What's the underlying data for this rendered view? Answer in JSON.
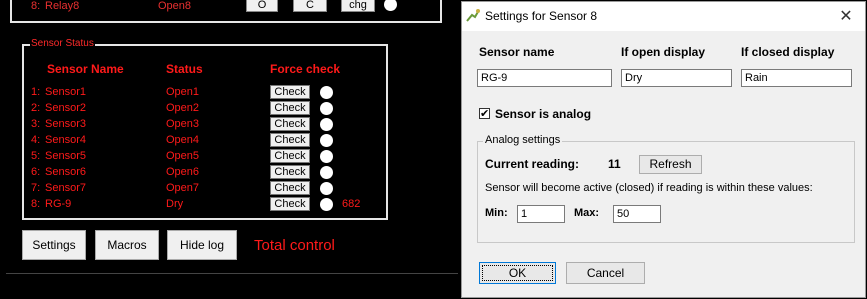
{
  "relay_row": {
    "index": "8:",
    "name": "Relay8",
    "status": "Open8",
    "btn_o": "O",
    "btn_c": "C",
    "btn_chg": "chg"
  },
  "sensor_status": {
    "group_label": "Sensor Status",
    "headers": {
      "name": "Sensor Name",
      "status": "Status",
      "force": "Force check"
    },
    "check_label": "Check",
    "rows": [
      {
        "index": "1:",
        "name": "Sensor1",
        "status": "Open1",
        "reading": ""
      },
      {
        "index": "2:",
        "name": "Sensor2",
        "status": "Open2",
        "reading": ""
      },
      {
        "index": "3:",
        "name": "Sensor3",
        "status": "Open3",
        "reading": ""
      },
      {
        "index": "4:",
        "name": "Sensor4",
        "status": "Open4",
        "reading": ""
      },
      {
        "index": "5:",
        "name": "Sensor5",
        "status": "Open5",
        "reading": ""
      },
      {
        "index": "6:",
        "name": "Sensor6",
        "status": "Open6",
        "reading": ""
      },
      {
        "index": "7:",
        "name": "Sensor7",
        "status": "Open7",
        "reading": ""
      },
      {
        "index": "8:",
        "name": "RG-9",
        "status": "Dry",
        "reading": "682"
      }
    ]
  },
  "bottom_bar": {
    "settings": "Settings",
    "macros": "Macros",
    "hide_log": "Hide log",
    "total_control": "Total control"
  },
  "dialog": {
    "title": "Settings for Sensor 8",
    "close": "✕",
    "labels": {
      "sensor_name": "Sensor name",
      "open_display": "If open display",
      "closed_display": "If closed display"
    },
    "values": {
      "sensor_name": "RG-9",
      "open_display": "Dry",
      "closed_display": "Rain"
    },
    "analog_checkbox": {
      "label": "Sensor is analog",
      "checked": "✔"
    },
    "analog": {
      "group_label": "Analog settings",
      "current_label": "Current reading:",
      "current_value": "11",
      "refresh": "Refresh",
      "description": "Sensor will become active (closed) if reading is within these values:",
      "min_label": "Min:",
      "min_value": "1",
      "max_label": "Max:",
      "max_value": "50"
    },
    "ok": "OK",
    "cancel": "Cancel"
  }
}
